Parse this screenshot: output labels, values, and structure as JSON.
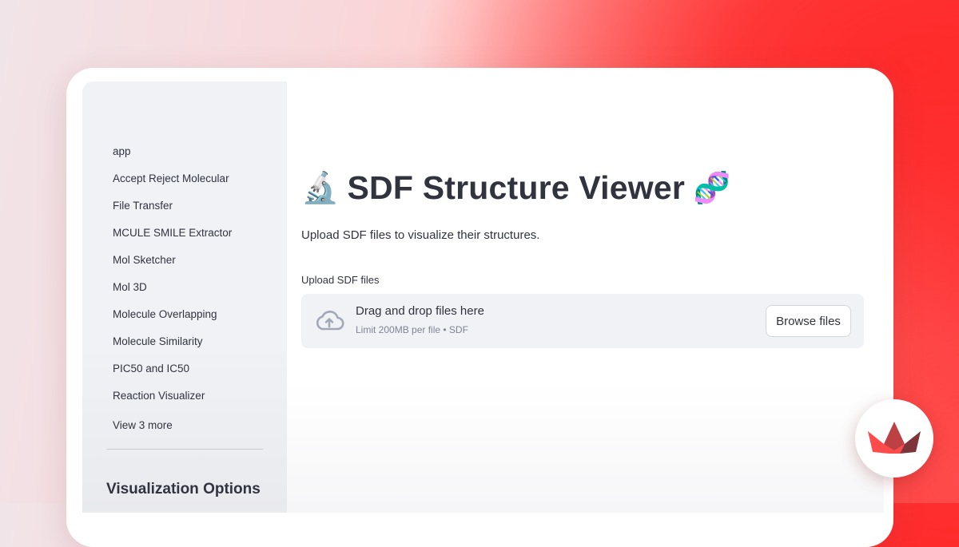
{
  "sidebar": {
    "nav_items": [
      {
        "label": "app"
      },
      {
        "label": "Accept Reject Molecular"
      },
      {
        "label": "File Transfer"
      },
      {
        "label": "MCULE SMILE Extractor"
      },
      {
        "label": "Mol Sketcher"
      },
      {
        "label": "Mol 3D"
      },
      {
        "label": "Molecule Overlapping"
      },
      {
        "label": "Molecule Similarity"
      },
      {
        "label": "PIC50 and IC50"
      },
      {
        "label": "Reaction Visualizer"
      }
    ],
    "view_more_label": "View 3 more",
    "section_heading": "Visualization Options"
  },
  "main": {
    "title_prefix_emoji": "🔬",
    "title": "SDF Structure Viewer",
    "title_suffix_emoji": "🧬",
    "subtitle": "Upload SDF files to visualize their structures.",
    "uploader": {
      "label": "Upload SDF files",
      "drop_text": "Drag and drop files here",
      "limit_text": "Limit 200MB per file • SDF",
      "browse_label": "Browse files",
      "icon": "cloud-upload-icon"
    }
  },
  "branding": {
    "logo": "streamlit-crown-logo"
  },
  "colors": {
    "accent": "#ff4b4b",
    "sidebar_bg": "#f0f2f6",
    "text": "#31333f",
    "muted_text": "#808495"
  }
}
